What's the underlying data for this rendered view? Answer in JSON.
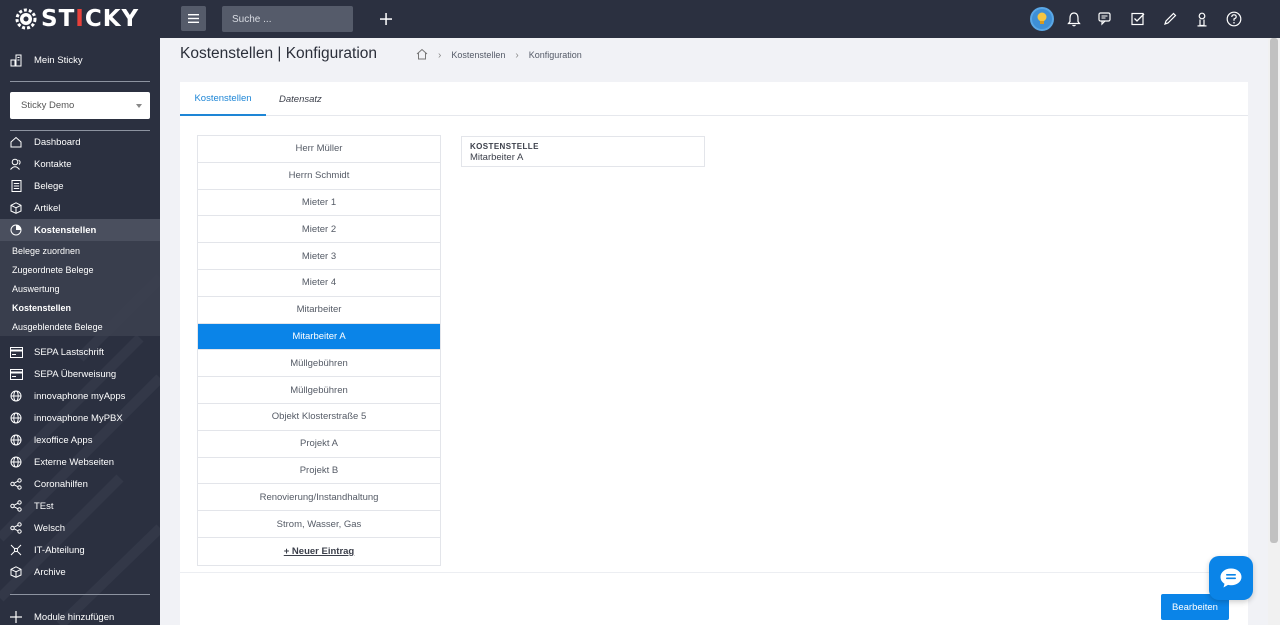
{
  "brand": {
    "logo_prefix": "ST",
    "logo_i": "I",
    "logo_suffix": "CKY"
  },
  "topbar": {
    "search_placeholder": "Suche ..."
  },
  "sidebar": {
    "home_label": "Mein Sticky",
    "workspace_select": "Sticky Demo",
    "items": [
      {
        "label": "Dashboard",
        "icon": "home-icon"
      },
      {
        "label": "Kontakte",
        "icon": "contacts-icon"
      },
      {
        "label": "Belege",
        "icon": "document-icon"
      },
      {
        "label": "Artikel",
        "icon": "box-icon"
      },
      {
        "label": "Kostenstellen",
        "icon": "pie-chart-icon"
      }
    ],
    "subitems": [
      {
        "label": "Belege zuordnen"
      },
      {
        "label": "Zugeordnete Belege"
      },
      {
        "label": "Auswertung"
      },
      {
        "label": "Kostenstellen"
      },
      {
        "label": "Ausgeblendete Belege"
      }
    ],
    "items2": [
      {
        "label": "SEPA Lastschrift",
        "icon": "bank-card-icon"
      },
      {
        "label": "SEPA Überweisung",
        "icon": "bank-card-icon"
      },
      {
        "label": "innovaphone myApps",
        "icon": "globe-icon"
      },
      {
        "label": "innovaphone MyPBX",
        "icon": "globe-icon"
      },
      {
        "label": "lexoffice Apps",
        "icon": "globe-icon"
      },
      {
        "label": "Externe Webseiten",
        "icon": "globe-icon"
      },
      {
        "label": "Coronahilfen",
        "icon": "share-icon"
      },
      {
        "label": "TEst",
        "icon": "share-icon"
      },
      {
        "label": "Welsch",
        "icon": "share-icon"
      },
      {
        "label": "IT-Abteilung",
        "icon": "network-icon"
      },
      {
        "label": "Archive",
        "icon": "box-icon"
      }
    ],
    "add_modules": "Module hinzufügen"
  },
  "header": {
    "title": "Kostenstellen | Konfiguration",
    "breadcrumb": [
      "Kostenstellen",
      "Konfiguration"
    ]
  },
  "tabs": [
    {
      "label": "Kostenstellen"
    },
    {
      "label": "Datensatz"
    }
  ],
  "list": {
    "entries": [
      "Herr Müller",
      "Herrn Schmidt",
      "Mieter 1",
      "Mieter 2",
      "Mieter 3",
      "Mieter 4",
      "Mitarbeiter",
      "Mitarbeiter A",
      "Müllgebühren",
      "Müllgebühren",
      "Objekt Klosterstraße 5",
      "Projekt A",
      "Projekt B",
      "Renovierung/Instandhaltung",
      "Strom, Wasser, Gas"
    ],
    "selected_index": 7,
    "new_entry": "+ Neuer Eintrag"
  },
  "detail": {
    "label": "KOSTENSTELLE",
    "value": "Mitarbeiter A"
  },
  "actions": {
    "edit": "Bearbeiten"
  },
  "colors": {
    "accent": "#0a84e8",
    "sidebar": "#2b3040",
    "logo_accent": "#e8403a"
  }
}
